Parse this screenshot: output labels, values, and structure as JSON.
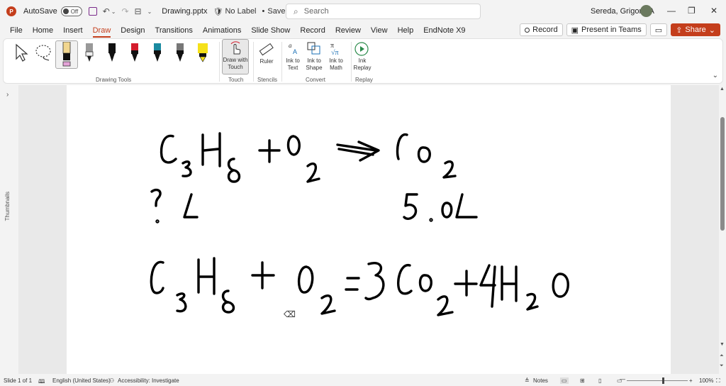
{
  "titlebar": {
    "app_icon_letter": "P",
    "autosave_label": "AutoSave",
    "autosave_state": "Off",
    "filename": "Drawing.pptx",
    "label_status": "No Label",
    "save_status": "Saved to this PC",
    "search_placeholder": "Search",
    "user_name": "Sereda, Grigoriy A"
  },
  "tabs": [
    "File",
    "Home",
    "Insert",
    "Draw",
    "Design",
    "Transitions",
    "Animations",
    "Slide Show",
    "Record",
    "Review",
    "View",
    "Help",
    "EndNote X9"
  ],
  "active_tab": "Draw",
  "header_buttons": {
    "record": "Record",
    "present": "Present in Teams",
    "share": "Share"
  },
  "ribbon": {
    "groups": {
      "drawing_tools": "Drawing Tools",
      "touch": "Touch",
      "stencils": "Stencils",
      "convert": "Convert",
      "replay": "Replay"
    },
    "draw_with_touch": "Draw with Touch",
    "ruler": "Ruler",
    "ink_to_text": "Ink to Text",
    "ink_to_shape": "Ink to Shape",
    "ink_to_math": "Ink to Math",
    "ink_replay": "Ink Replay",
    "pen_colors": [
      "#111111",
      "#111111",
      "#d41c2c",
      "#1a8aa0",
      "#444444",
      "#f5e11a"
    ]
  },
  "thumbnails_label": "Thumbnails",
  "status": {
    "slide": "Slide 1 of 1",
    "language": "English (United States)",
    "accessibility": "Accessibility: Investigate",
    "notes": "Notes",
    "zoom": "100%"
  },
  "slide_ink": {
    "line1": "C3H8 + O2 → CO2",
    "line2_left": "? L",
    "line2_right": "5.0 L",
    "line3": "C3H8 + O2 = 3CO2 + 4H2O"
  }
}
